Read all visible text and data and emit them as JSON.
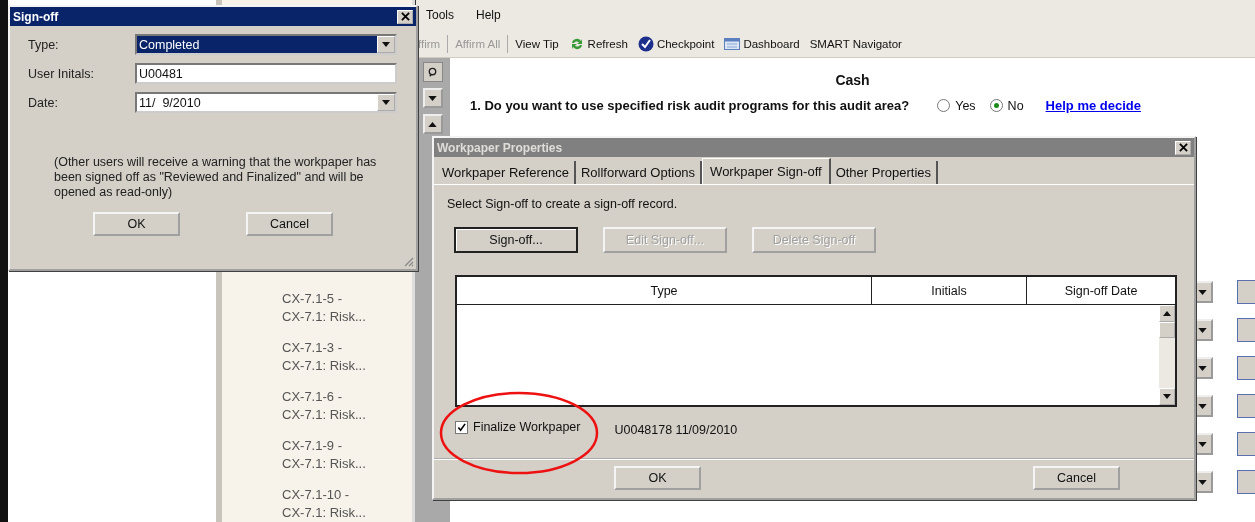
{
  "menu": [
    "Tools",
    "Help"
  ],
  "toolbar": [
    {
      "label": "ffirm",
      "disabled": true,
      "kind": "text"
    },
    {
      "label": "Affirm All",
      "disabled": true,
      "kind": "text"
    },
    {
      "label": "View Tip",
      "disabled": false,
      "kind": "text"
    },
    {
      "label": "Refresh",
      "disabled": false,
      "kind": "refresh"
    },
    {
      "label": "Checkpoint",
      "disabled": false,
      "kind": "check"
    },
    {
      "label": "Dashboard",
      "disabled": false,
      "kind": "dashboard"
    },
    {
      "label": "SMART Navigator",
      "disabled": false,
      "kind": "text"
    }
  ],
  "list_items": [
    {
      "code": "CX-7.1-5 -",
      "title": "CX-7.1: Risk..."
    },
    {
      "code": "CX-7.1-3 -",
      "title": "CX-7.1: Risk..."
    },
    {
      "code": "CX-7.1-6 -",
      "title": "CX-7.1: Risk..."
    },
    {
      "code": "CX-7.1-9 -",
      "title": "CX-7.1: Risk..."
    },
    {
      "code": "CX-7.1-10 -",
      "title": "CX-7.1: Risk..."
    }
  ],
  "content": {
    "heading": "Cash",
    "question": "1. Do you want to use specified risk audit programs for this audit area?",
    "options": [
      {
        "label": "Yes",
        "selected": false
      },
      {
        "label": "No",
        "selected": true
      }
    ],
    "help_link": "Help me decide"
  },
  "sign_off_dialog": {
    "title": "Sign-off",
    "fields": [
      {
        "kind": "select",
        "label": "Type:",
        "value": "Completed",
        "highlighted": true
      },
      {
        "kind": "text",
        "label": "User Initals:",
        "value": "U00481",
        "highlighted": false
      },
      {
        "kind": "select",
        "label": "Date:",
        "value": "11/  9/2010",
        "highlighted": false
      }
    ],
    "note": "(Other users will receive a warning that the workpaper has been signed off as \"Reviewed and Finalized\" and will be opened as read-only)",
    "buttons": [
      "OK",
      "Cancel"
    ]
  },
  "workpaper_dialog": {
    "title": "Workpaper Properties",
    "tabs": [
      {
        "label": "Workpaper Reference",
        "selected": false
      },
      {
        "label": "Rollforward Options",
        "selected": false
      },
      {
        "label": "Workpaper Sign-off",
        "selected": true
      },
      {
        "label": "Other Properties",
        "selected": false
      }
    ],
    "instruction": "Select Sign-off to create a sign-off record.",
    "actions": [
      {
        "label": "Sign-off...",
        "disabled": false
      },
      {
        "label": "Edit Sign-off...",
        "disabled": true
      },
      {
        "label": "Delete Sign-off",
        "disabled": true
      }
    ],
    "table": {
      "columns": [
        "Type",
        "Initials",
        "Sign-off Date"
      ]
    },
    "finalize": {
      "label": "Finalize Workpaper",
      "checked": true,
      "circled": true
    },
    "signed_by": "U0048178 11/09/2010",
    "buttons": [
      "OK",
      "Cancel"
    ]
  }
}
